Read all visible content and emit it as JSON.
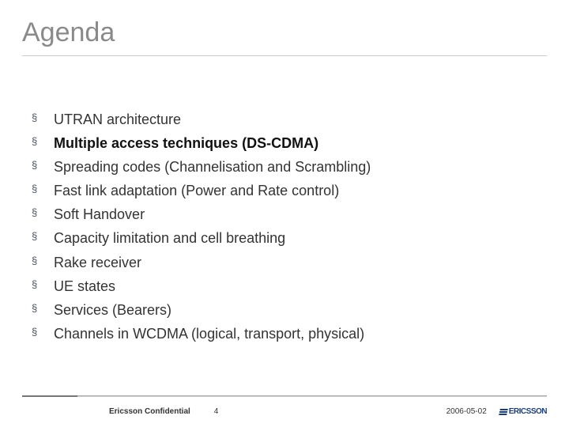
{
  "title": "Agenda",
  "bullets": [
    {
      "mark": "§",
      "text": "UTRAN architecture",
      "bold": false
    },
    {
      "mark": "§",
      "text": "Multiple access techniques (DS-CDMA)",
      "bold": true
    },
    {
      "mark": "§",
      "text": "Spreading codes (Channelisation and Scrambling)",
      "bold": false
    },
    {
      "mark": "§",
      "text": "Fast link adaptation (Power and Rate control)",
      "bold": false
    },
    {
      "mark": "§",
      "text": "Soft Handover",
      "bold": false
    },
    {
      "mark": "§",
      "text": "Capacity limitation and cell breathing",
      "bold": false
    },
    {
      "mark": "§",
      "text": "Rake receiver",
      "bold": false
    },
    {
      "mark": "§",
      "text": "UE states",
      "bold": false
    },
    {
      "mark": "§",
      "text": "Services (Bearers)",
      "bold": false
    },
    {
      "mark": "§",
      "text": "Channels in WCDMA (logical, transport, physical)",
      "bold": false
    }
  ],
  "footer": {
    "confidential": "Ericsson Confidential",
    "page": "4",
    "date": "2006-05-02",
    "logo_text": "ERICSSON"
  }
}
